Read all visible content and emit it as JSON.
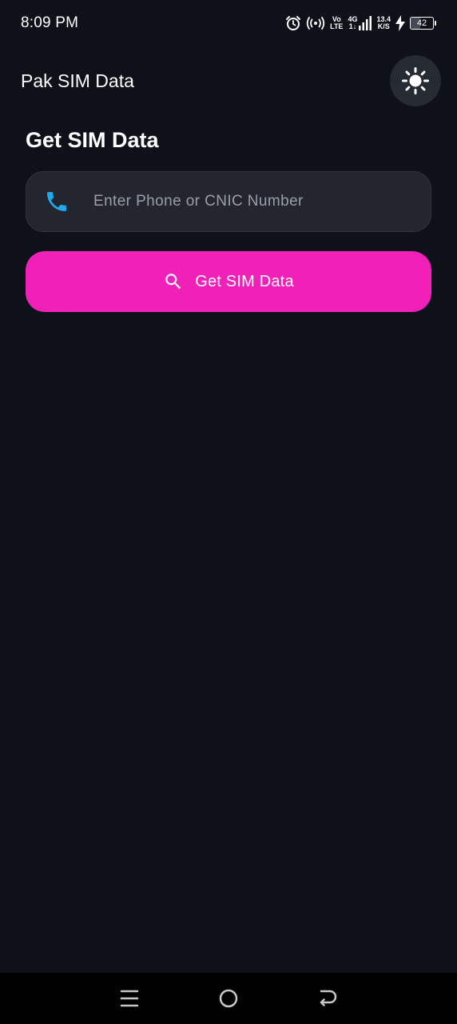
{
  "status_bar": {
    "time": "8:09 PM",
    "volte_top": "Vo",
    "volte_bottom": "LTE",
    "network_top": "4G",
    "network_bottom": "1↓",
    "speed_value": "13.4",
    "speed_unit": "K/S",
    "battery_level": "42",
    "icons": [
      "alarm-icon",
      "hotspot-icon",
      "volte-icon",
      "network-4g-icon",
      "signal-icon",
      "speed-icon",
      "charging-icon",
      "battery-icon"
    ]
  },
  "app_bar": {
    "title": "Pak SIM Data",
    "theme_toggle_icon": "sun-icon"
  },
  "form": {
    "heading": "Get SIM Data",
    "input": {
      "value": "",
      "placeholder": "Enter Phone or CNIC Number",
      "icon": "phone-icon"
    },
    "button": {
      "label": "Get SIM Data",
      "icon": "search-icon"
    }
  },
  "nav_bar": {
    "icons": [
      "menu-icon",
      "home-icon",
      "back-icon"
    ]
  },
  "colors": {
    "background": "#0e1119",
    "input_background": "#23262e",
    "accent_button": "#f020b8",
    "phone_icon": "#1fa8ee",
    "toggle_background": "#262a33",
    "nav_background": "#000000"
  }
}
